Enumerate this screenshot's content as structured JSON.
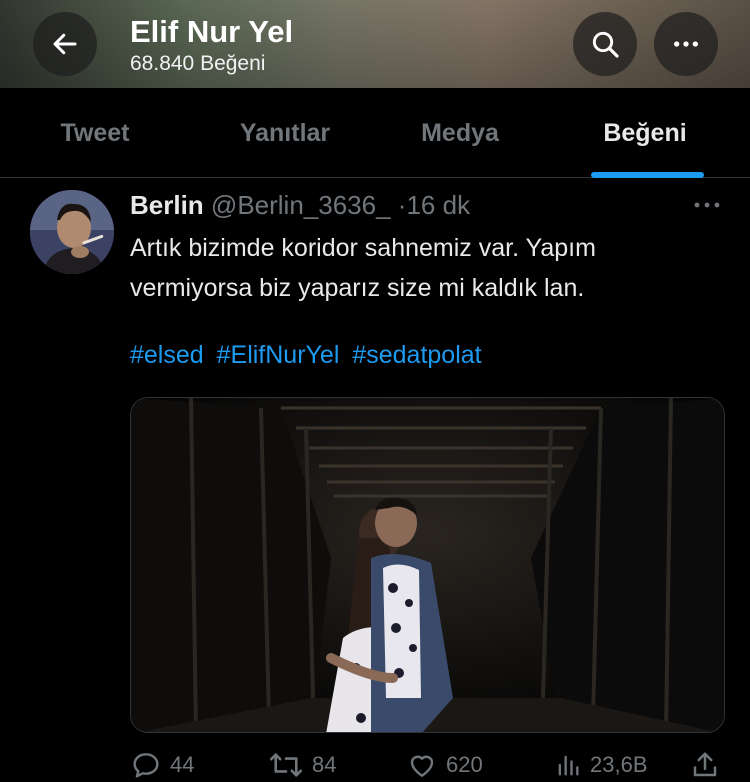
{
  "header": {
    "title": "Elif Nur Yel",
    "subtitle": "68.840 Beğeni",
    "icons": {
      "back": "arrow-left-icon",
      "search": "search-icon",
      "more": "more-horizontal-icon"
    }
  },
  "tabs": [
    {
      "label": "Tweet",
      "active": false
    },
    {
      "label": "Yanıtlar",
      "active": false
    },
    {
      "label": "Medya",
      "active": false
    },
    {
      "label": "Beğeni",
      "active": true
    }
  ],
  "tweet": {
    "author_name": "Berlin",
    "author_handle": "@Berlin_3636_",
    "separator": "·",
    "time": "16 dk",
    "text": "Artık bizimde koridor sahnemiz var. Yapım vermiyorsa biz yaparız size mi kaldık lan.",
    "hashtags": [
      "#elsed",
      "#ElifNurYel",
      "#sedatpolat"
    ],
    "stats": {
      "replies": "44",
      "retweets": "84",
      "likes": "620",
      "views": "23,6B"
    }
  },
  "colors": {
    "background": "#000000",
    "accent": "#1d9bf0",
    "muted": "#71767b",
    "text": "#e7e9ea"
  }
}
